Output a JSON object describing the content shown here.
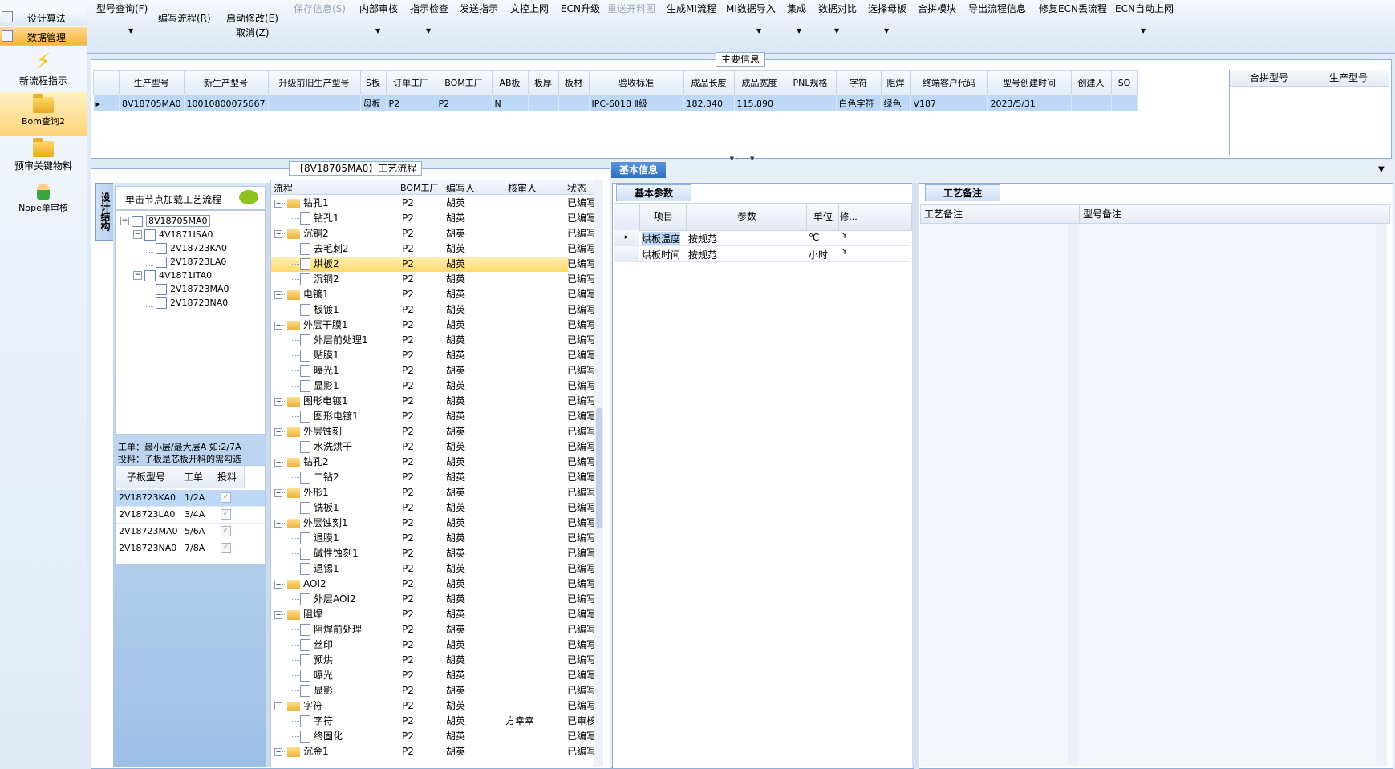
{
  "leftnav": {
    "rows": [
      {
        "label": "设计算法"
      },
      {
        "label": "数据管理"
      }
    ],
    "buttons": [
      {
        "label": "新流程指示",
        "icon": "lightning-icon"
      },
      {
        "label": "Bom查询2",
        "icon": "folder-icon"
      },
      {
        "label": "预审关键物料",
        "icon": "folder-icon"
      },
      {
        "label": "Nope单审核",
        "icon": "user-icon"
      }
    ]
  },
  "toolbar": {
    "items": [
      {
        "label": "型号查询(F)"
      },
      {
        "label": "编写流程(R)"
      },
      {
        "label": "启动修改(E)"
      },
      {
        "label": "取消(Z)"
      },
      {
        "label": "保存信息(S)"
      },
      {
        "label": "内部审核"
      },
      {
        "label": "指示检查"
      },
      {
        "label": "发送指示"
      },
      {
        "label": "文控上网"
      },
      {
        "label": "ECN升级"
      },
      {
        "label": "重送开料图"
      },
      {
        "label": "生成MI流程"
      },
      {
        "label": "MI数据导入"
      },
      {
        "label": "集成"
      },
      {
        "label": "数据对比"
      },
      {
        "label": "选择母板"
      },
      {
        "label": "合拼模块"
      },
      {
        "label": "导出流程信息"
      },
      {
        "label": "修复ECN丢流程"
      },
      {
        "label": "ECN自动上网"
      }
    ]
  },
  "main_info": {
    "title": "主要信息",
    "columns": [
      "生产型号",
      "新生产型号",
      "升级前旧生产型号",
      "S板",
      "订单工厂",
      "BOM工厂",
      "AB板",
      "板厚",
      "板材",
      "验收标准",
      "成品长度",
      "成品宽度",
      "PNL规格",
      "字符",
      "阻焊",
      "终端客户代码",
      "型号创建时间",
      "创建人",
      "SO"
    ],
    "row": [
      "8V18705MA0",
      "10010800075667",
      "",
      "母板",
      "P2",
      "P2",
      "N",
      "",
      "",
      "IPC-6018 Ⅱ级",
      "182.340",
      "115.890",
      "",
      "白色字符",
      "绿色",
      "V187",
      "2023/5/31",
      "",
      ""
    ],
    "right_columns": [
      "合拼型号",
      "生产型号"
    ]
  },
  "process_panel": {
    "title": "【8V18705MA0】工艺流程",
    "side_tab": "设计结构",
    "hint": "单击节点加载工艺流程",
    "tree": [
      {
        "label": "8V18705MA0",
        "level": 0
      },
      {
        "label": "4V1871ISA0",
        "level": 1
      },
      {
        "label": "2V18723KA0",
        "level": 2
      },
      {
        "label": "2V18723LA0",
        "level": 2
      },
      {
        "label": "4V1871ITA0",
        "level": 1
      },
      {
        "label": "2V18723MA0",
        "level": 2
      },
      {
        "label": "2V18723NA0",
        "level": 2
      }
    ],
    "note1": "工单：最小层/最大层A 如:2/7A",
    "note2": "投料：子板是芯板开料的需勾选",
    "sub_columns": [
      "子板型号",
      "工单",
      "投料"
    ],
    "sub_rows": [
      {
        "model": "2V18723KA0",
        "order": "1/2A"
      },
      {
        "model": "2V18723LA0",
        "order": "3/4A"
      },
      {
        "model": "2V18723MA0",
        "order": "5/6A"
      },
      {
        "model": "2V18723NA0",
        "order": "7/8A"
      }
    ]
  },
  "flow_grid": {
    "columns": [
      "流程",
      "BOM工厂",
      "编写人",
      "核审人",
      "状态"
    ],
    "rows": [
      {
        "name": "钻孔1",
        "folder": true,
        "factory": "P2",
        "author": "胡英",
        "reviewer": "",
        "status": "已编写"
      },
      {
        "name": "钻孔1",
        "folder": false,
        "factory": "P2",
        "author": "胡英",
        "reviewer": "",
        "status": "已编写"
      },
      {
        "name": "沉铜2",
        "folder": true,
        "factory": "P2",
        "author": "胡英",
        "reviewer": "",
        "status": "已编写"
      },
      {
        "name": "去毛刺2",
        "folder": false,
        "factory": "P2",
        "author": "胡英",
        "reviewer": "",
        "status": "已编写"
      },
      {
        "name": "烘板2",
        "folder": false,
        "factory": "P2",
        "author": "胡英",
        "reviewer": "",
        "status": "已编写",
        "selected": true
      },
      {
        "name": "沉铜2",
        "folder": false,
        "factory": "P2",
        "author": "胡英",
        "reviewer": "",
        "status": "已编写"
      },
      {
        "name": "电镀1",
        "folder": true,
        "factory": "P2",
        "author": "胡英",
        "reviewer": "",
        "status": "已编写"
      },
      {
        "name": "板镀1",
        "folder": false,
        "factory": "P2",
        "author": "胡英",
        "reviewer": "",
        "status": "已编写"
      },
      {
        "name": "外层干膜1",
        "folder": true,
        "factory": "P2",
        "author": "胡英",
        "reviewer": "",
        "status": "已编写"
      },
      {
        "name": "外层前处理1",
        "folder": false,
        "factory": "P2",
        "author": "胡英",
        "reviewer": "",
        "status": "已编写"
      },
      {
        "name": "贴膜1",
        "folder": false,
        "factory": "P2",
        "author": "胡英",
        "reviewer": "",
        "status": "已编写"
      },
      {
        "name": "曝光1",
        "folder": false,
        "factory": "P2",
        "author": "胡英",
        "reviewer": "",
        "status": "已编写"
      },
      {
        "name": "显影1",
        "folder": false,
        "factory": "P2",
        "author": "胡英",
        "reviewer": "",
        "status": "已编写"
      },
      {
        "name": "图形电镀1",
        "folder": true,
        "factory": "P2",
        "author": "胡英",
        "reviewer": "",
        "status": "已编写"
      },
      {
        "name": "图形电镀1",
        "folder": false,
        "factory": "P2",
        "author": "胡英",
        "reviewer": "",
        "status": "已编写"
      },
      {
        "name": "外层蚀刻",
        "folder": true,
        "factory": "P2",
        "author": "胡英",
        "reviewer": "",
        "status": "已编写"
      },
      {
        "name": "水洗烘干",
        "folder": false,
        "factory": "P2",
        "author": "胡英",
        "reviewer": "",
        "status": "已编写"
      },
      {
        "name": "钻孔2",
        "folder": true,
        "factory": "P2",
        "author": "胡英",
        "reviewer": "",
        "status": "已编写"
      },
      {
        "name": "二钻2",
        "folder": false,
        "factory": "P2",
        "author": "胡英",
        "reviewer": "",
        "status": "已编写"
      },
      {
        "name": "外形1",
        "folder": true,
        "factory": "P2",
        "author": "胡英",
        "reviewer": "",
        "status": "已编写"
      },
      {
        "name": "铣板1",
        "folder": false,
        "factory": "P2",
        "author": "胡英",
        "reviewer": "",
        "status": "已编写"
      },
      {
        "name": "外层蚀刻1",
        "folder": true,
        "factory": "P2",
        "author": "胡英",
        "reviewer": "",
        "status": "已编写"
      },
      {
        "name": "退膜1",
        "folder": false,
        "factory": "P2",
        "author": "胡英",
        "reviewer": "",
        "status": "已编写"
      },
      {
        "name": "碱性蚀刻1",
        "folder": false,
        "factory": "P2",
        "author": "胡英",
        "reviewer": "",
        "status": "已编写"
      },
      {
        "name": "退锡1",
        "folder": false,
        "factory": "P2",
        "author": "胡英",
        "reviewer": "",
        "status": "已编写"
      },
      {
        "name": "AOI2",
        "folder": true,
        "factory": "P2",
        "author": "胡英",
        "reviewer": "",
        "status": "已编写"
      },
      {
        "name": "外层AOI2",
        "folder": false,
        "factory": "P2",
        "author": "胡英",
        "reviewer": "",
        "status": "已编写"
      },
      {
        "name": "阻焊",
        "folder": true,
        "factory": "P2",
        "author": "胡英",
        "reviewer": "",
        "status": "已编写"
      },
      {
        "name": "阻焊前处理",
        "folder": false,
        "factory": "P2",
        "author": "胡英",
        "reviewer": "",
        "status": "已编写"
      },
      {
        "name": "丝印",
        "folder": false,
        "factory": "P2",
        "author": "胡英",
        "reviewer": "",
        "status": "已编写"
      },
      {
        "name": "预烘",
        "folder": false,
        "factory": "P2",
        "author": "胡英",
        "reviewer": "",
        "status": "已编写"
      },
      {
        "name": "曝光",
        "folder": false,
        "factory": "P2",
        "author": "胡英",
        "reviewer": "",
        "status": "已编写"
      },
      {
        "name": "显影",
        "folder": false,
        "factory": "P2",
        "author": "胡英",
        "reviewer": "",
        "status": "已编写"
      },
      {
        "name": "字符",
        "folder": true,
        "factory": "P2",
        "author": "胡英",
        "reviewer": "",
        "status": "已编写"
      },
      {
        "name": "字符",
        "folder": false,
        "factory": "P2",
        "author": "胡英",
        "reviewer": "方幸幸",
        "status": "已审核"
      },
      {
        "name": "终固化",
        "folder": false,
        "factory": "P2",
        "author": "胡英",
        "reviewer": "",
        "status": "已编写"
      },
      {
        "name": "沉金1",
        "folder": true,
        "factory": "P2",
        "author": "胡英",
        "reviewer": "",
        "status": "已编写"
      }
    ]
  },
  "basic_info": {
    "tab": "基本信息",
    "subtab": "基本参数",
    "columns": [
      "项目",
      "参数",
      "单位",
      "修..."
    ],
    "rows": [
      {
        "item": "烘板温度",
        "param": "按规范",
        "unit": "℃",
        "mod": "Y"
      },
      {
        "item": "烘板时间",
        "param": "按规范",
        "unit": "小时",
        "mod": "Y"
      }
    ]
  },
  "remarks": {
    "tab": "工艺备注",
    "columns": [
      "工艺备注",
      "型号备注"
    ]
  }
}
